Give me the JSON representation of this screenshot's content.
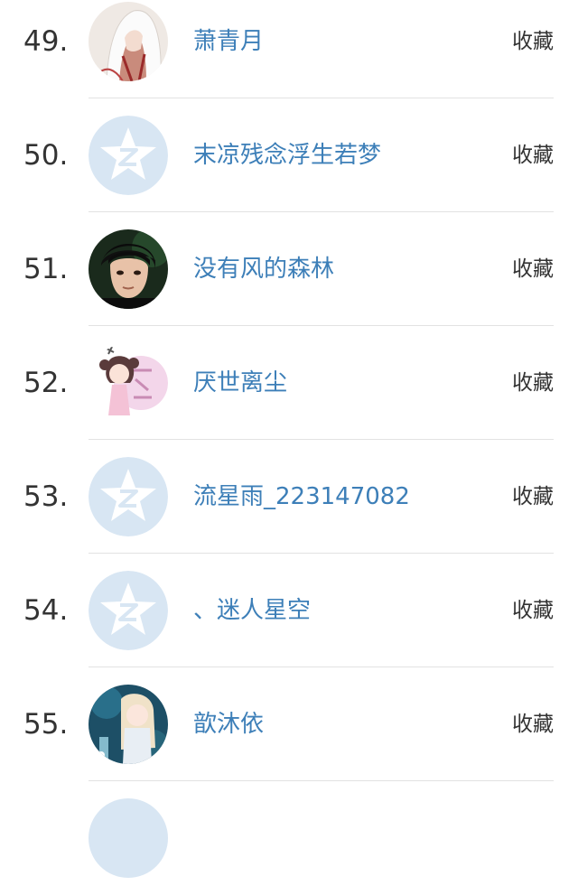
{
  "items": [
    {
      "rank": "49.",
      "name": "萧青月",
      "action": "收藏",
      "avatar": "photo-white-hood"
    },
    {
      "rank": "50.",
      "name": "末凉残念浮生若梦",
      "action": "收藏",
      "avatar": "default-star"
    },
    {
      "rank": "51.",
      "name": "没有风的森林",
      "action": "收藏",
      "avatar": "photo-dark-portrait"
    },
    {
      "rank": "52.",
      "name": "厌世离尘",
      "action": "收藏",
      "avatar": "photo-anime-girl-pink"
    },
    {
      "rank": "53.",
      "name": "流星雨_223147082",
      "action": "收藏",
      "avatar": "default-star"
    },
    {
      "rank": "54.",
      "name": "、迷人星空",
      "action": "收藏",
      "avatar": "default-star"
    },
    {
      "rank": "55.",
      "name": "歆沐依",
      "action": "收藏",
      "avatar": "photo-anime-girl-blue"
    }
  ],
  "colors": {
    "name_link": "#3d7fb8",
    "default_avatar_bg": "#d8e6f3",
    "text": "#333333",
    "divider": "#e2e2e2"
  }
}
